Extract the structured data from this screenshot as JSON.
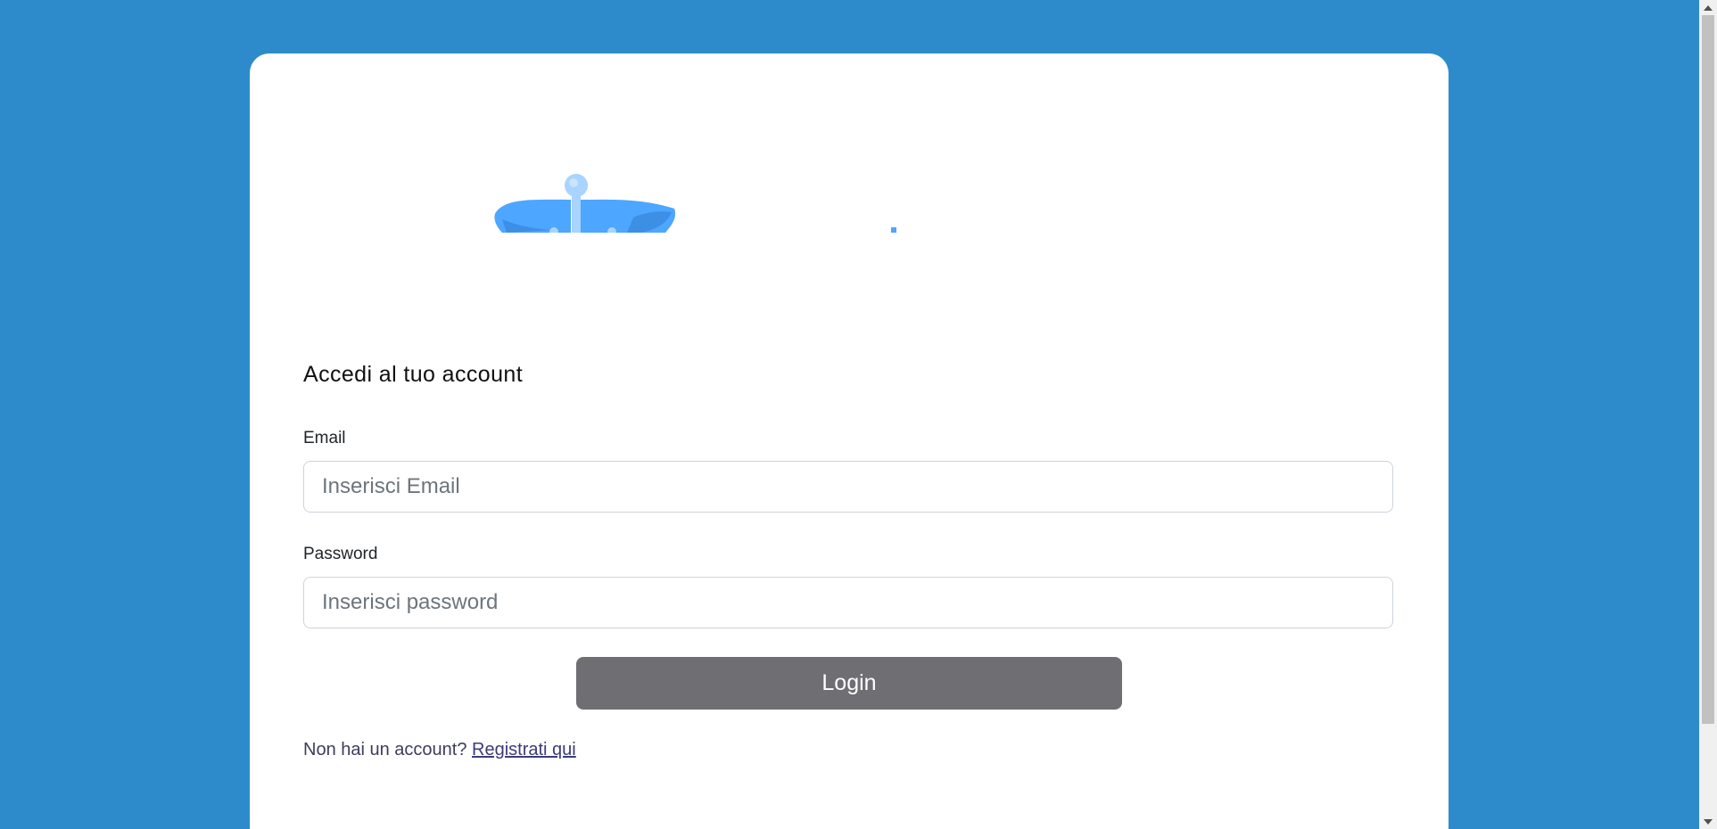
{
  "login": {
    "title": "Accedi al tuo account",
    "email_label": "Email",
    "email_placeholder": "Inserisci Email",
    "email_value": "",
    "password_label": "Password",
    "password_placeholder": "Inserisci password",
    "password_value": "",
    "submit_label": "Login",
    "register_prompt": "Non hai un account?",
    "register_link": "Registrati qui"
  },
  "logo": {
    "icon": "caduceus-wings-logo"
  },
  "colors": {
    "background": "#2e8bcb",
    "card": "#ffffff",
    "button": "#6f6f73",
    "logo_primary": "#4da6ff",
    "logo_secondary": "#a8d4ff"
  }
}
